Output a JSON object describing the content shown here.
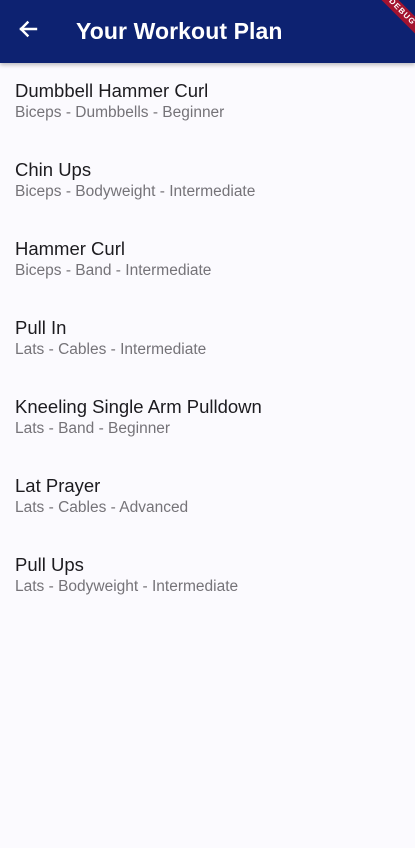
{
  "colors": {
    "appbar_bg": "#0d2271",
    "appbar_text": "#ffffff",
    "page_bg": "#fbfafe",
    "title_text": "#1c1b1f",
    "subtitle_text": "#757378",
    "debug_banner": "#a3132f"
  },
  "appbar": {
    "back_icon": "arrow-back-icon",
    "title": "Your Workout Plan",
    "debug_banner": "DEBUG"
  },
  "exercises": [
    {
      "name": "Dumbbell Hammer Curl",
      "details": "Biceps - Dumbbells - Beginner"
    },
    {
      "name": "Chin Ups",
      "details": "Biceps - Bodyweight - Intermediate"
    },
    {
      "name": "Hammer Curl",
      "details": "Biceps - Band - Intermediate"
    },
    {
      "name": "Pull In",
      "details": "Lats - Cables - Intermediate"
    },
    {
      "name": "Kneeling Single Arm Pulldown",
      "details": "Lats - Band - Beginner"
    },
    {
      "name": "Lat Prayer",
      "details": "Lats - Cables - Advanced"
    },
    {
      "name": "Pull Ups",
      "details": "Lats - Bodyweight - Intermediate"
    }
  ]
}
